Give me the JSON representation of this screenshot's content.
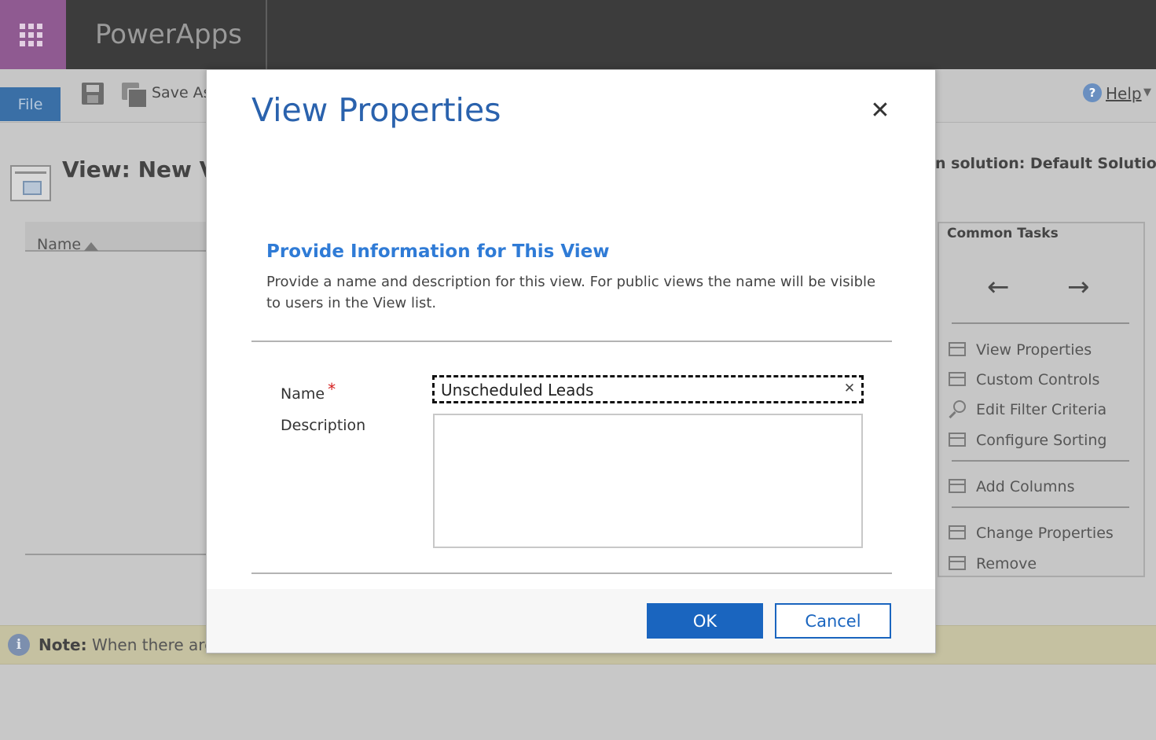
{
  "app": {
    "title": "PowerApps"
  },
  "ribbon": {
    "file_label": "File",
    "save_as_label": "Save As",
    "help_label": "Help",
    "help_icon_glyph": "?"
  },
  "page": {
    "title": "View: New Vi",
    "solution_label": "n solution: Default Solution",
    "column_header": "Name"
  },
  "common_tasks": {
    "title": "Common Tasks",
    "back_arrow": "←",
    "forward_arrow": "→",
    "items": [
      {
        "label": "View Properties",
        "icon": "view-properties-icon"
      },
      {
        "label": "Custom Controls",
        "icon": "custom-controls-icon"
      },
      {
        "label": "Edit Filter Criteria",
        "icon": "edit-filter-icon"
      },
      {
        "label": "Configure Sorting",
        "icon": "configure-sorting-icon"
      },
      {
        "label": "Add Columns",
        "icon": "add-columns-icon"
      },
      {
        "label": "Change Properties",
        "icon": "change-properties-icon"
      },
      {
        "label": "Remove",
        "icon": "remove-icon"
      }
    ]
  },
  "note": {
    "icon_glyph": "i",
    "label": "Note:",
    "text": " When there are to"
  },
  "dialog": {
    "title": "View Properties",
    "close_glyph": "✕",
    "section_heading": "Provide Information for This View",
    "section_description": "Provide a name and description for this view. For public views the name will be visible to users in the View list.",
    "name_label": "Name",
    "required_marker": "*",
    "name_value": "Unscheduled Leads",
    "clear_glyph": "✕",
    "description_label": "Description",
    "description_value": "",
    "ok_label": "OK",
    "cancel_label": "Cancel"
  },
  "colors": {
    "waffle_bg": "#8f5a91",
    "appbar_bg": "#3c3c3c",
    "accent_blue": "#1a65bf",
    "title_blue": "#2a62ad",
    "heading_blue": "#2f7bd6",
    "required_red": "#d41f1f",
    "note_bg": "#c5c1a1"
  }
}
